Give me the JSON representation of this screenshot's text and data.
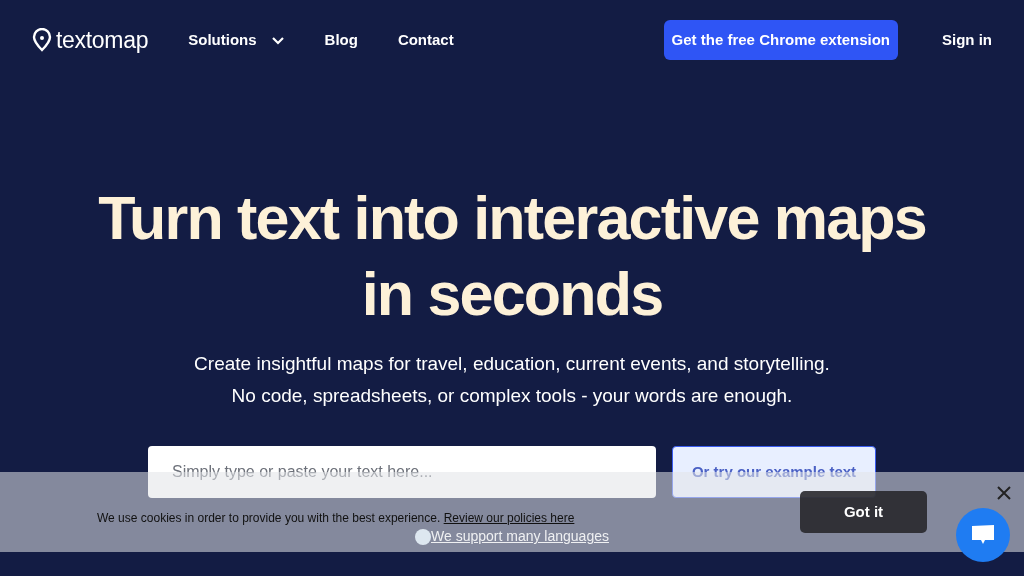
{
  "navbar": {
    "logo": "textomap",
    "menu": [
      {
        "label": "Solutions",
        "kind": "dropdown"
      },
      {
        "label": "Blog",
        "kind": "link"
      },
      {
        "label": "Contact",
        "kind": "link"
      }
    ],
    "cta_button": "Get the free Chrome extension",
    "sign_in": "Sign in"
  },
  "hero": {
    "title": "Turn text into interactive maps in seconds",
    "subtitle_lines": [
      "Create insightful maps for travel, education, current events, and storytelling.",
      "No code, spreadsheets, or complex tools - your words are enough."
    ],
    "input": {
      "placeholder": "Simply type or paste your text here..."
    },
    "example_button": "Or try our example text",
    "languages_link": "We support many languages"
  },
  "cookie_banner": {
    "text": "We use cookies in order to provide you with the best experience.",
    "link": "Review our policies here",
    "button": "Got it"
  }
}
